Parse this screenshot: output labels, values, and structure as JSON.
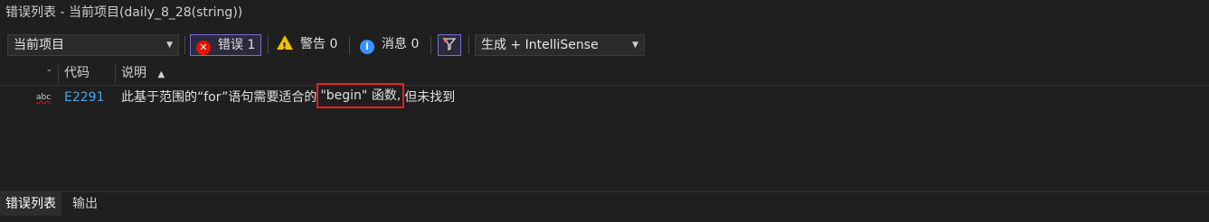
{
  "window": {
    "title": "错误列表 - 当前项目(daily_8_28(string))"
  },
  "toolbar": {
    "scope_value": "当前项目",
    "errors_label": "错误 1",
    "warnings_label": "警告 0",
    "messages_label": "消息 0",
    "build_filter_value": "生成 + IntelliSense"
  },
  "columns": {
    "code": "代码",
    "description": "说明",
    "sort_indicator": "▲"
  },
  "errors": [
    {
      "icon": "abc",
      "code": "E2291",
      "description_before": "此基于范围的“for”语句需要适合的",
      "description_highlight": "\"begin\" 函数,",
      "description_after": "但未找到"
    }
  ],
  "tabs": [
    {
      "label": "错误列表",
      "active": true
    },
    {
      "label": "输出",
      "active": false
    }
  ],
  "colors": {
    "error": "#e51400",
    "warning": "#f2c100",
    "info": "#3794ff",
    "link": "#4aa3e8",
    "highlight_border": "#e02020"
  }
}
